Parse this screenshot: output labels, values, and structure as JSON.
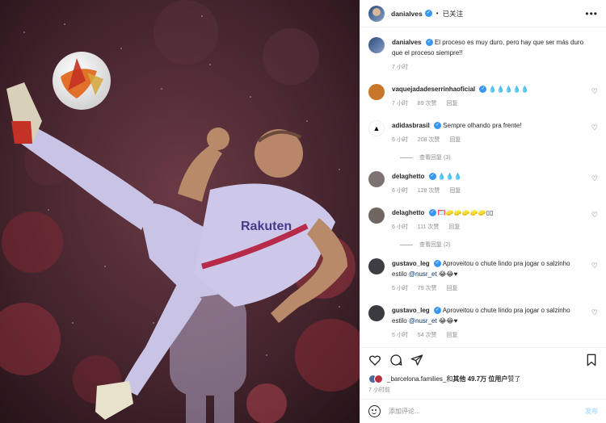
{
  "post_header": {
    "username": "danialves",
    "separator": "•",
    "follow_status": "已关注",
    "more_label": "•••"
  },
  "caption": {
    "username": "danialves",
    "text": "El proceso es muy duro, pero hay que ser más duro que el proceso siempre!!",
    "time": "7 小时"
  },
  "comments": [
    {
      "username": "vaquejadadeserrinhaoficial",
      "text": "💧💧💧💧💧",
      "time": "7 小时",
      "likes": "89 次赞",
      "reply": "回复",
      "avatar_color": "#c8762a"
    },
    {
      "username": "adidasbrasil",
      "text": "Sempre olhando pra frente!",
      "time": "6 小时",
      "likes": "208 次赞",
      "reply": "回复",
      "avatar_color": "#ffffff",
      "view_replies": "查看回复 (3)"
    },
    {
      "username": "delaghetto",
      "text": "💧💧💧",
      "time": "6 小时",
      "likes": "128 次赞",
      "reply": "回复",
      "avatar_color": "#7d7370"
    },
    {
      "username": "delaghetto",
      "text": "🥅🧽🧽🧽🧽🧽▯▯",
      "time": "6 小时",
      "likes": "111 次赞",
      "reply": "回复",
      "avatar_color": "#6f6662",
      "view_replies": "查看回复 (2)"
    },
    {
      "username": "gustavo_leg",
      "text": "Aproveitou o chute lindo pra jogar o salzinho estilo ",
      "mention": "@nusr_et",
      "suffix": " 😂😂♥",
      "time": "5 小时",
      "likes": "79 次赞",
      "reply": "回复",
      "avatar_color": "#3d3d44"
    },
    {
      "username": "gustavo_leg",
      "text": "Aproveitou o chute lindo pra jogar o salzinho estilo ",
      "mention": "@nusr_et",
      "suffix": " 😂😂♥",
      "time": "5 小时",
      "likes": "54 次赞",
      "reply": "回复",
      "avatar_color": "#3a3a40"
    }
  ],
  "likes_line": {
    "liker": "_barcelona.families_",
    "and": " 和 ",
    "others": "其他 49.7万 位用户",
    "liked": " 赞了"
  },
  "post_time": "7 小时前",
  "add_comment": {
    "placeholder": "添加评论...",
    "post_label": "发布"
  },
  "icons": {
    "like": "heart-icon",
    "comment": "comment-icon",
    "share": "share-icon",
    "save": "bookmark-icon",
    "emoji": "emoji-icon"
  },
  "colors": {
    "verified": "#3897f0",
    "meta_gray": "#8e8e8e",
    "post_button": "#b2dffc",
    "mention": "#00376b",
    "kit": "#c9c4e6"
  }
}
